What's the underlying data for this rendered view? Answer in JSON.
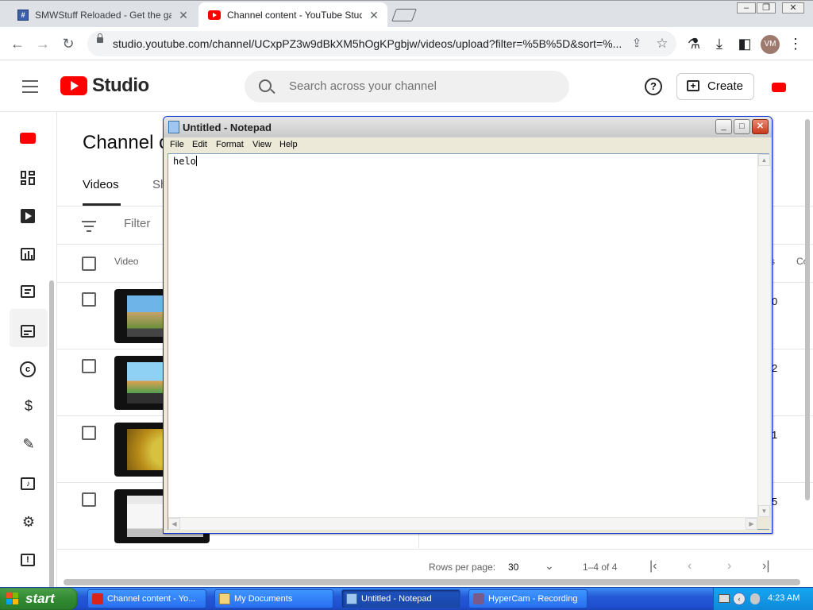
{
  "browser": {
    "tabs": [
      {
        "title": "SMWStuff Reloaded - Get the game",
        "favicon": "smw-favicon",
        "active": false
      },
      {
        "title": "Channel content - YouTube Studio",
        "favicon": "youtube-favicon",
        "active": true
      }
    ],
    "url": "studio.youtube.com/channel/UCxpPZ3w9dBkXM5hOgKPgbjw/videos/upload?filter=%5B%5D&sort=%...",
    "profile_initials": "VM"
  },
  "studio": {
    "logo_text": "Studio",
    "search_placeholder": "Search across your channel",
    "help_glyph": "?",
    "create_label": "Create",
    "page_title": "Channel c",
    "tabs": [
      {
        "label": "Videos"
      },
      {
        "label": "Sh"
      }
    ],
    "filter_label": "Filter",
    "table": {
      "video_header": "Video",
      "right_header_1": "s",
      "right_header_2": "Co",
      "rows": [
        {
          "value_fragment": "0"
        },
        {
          "value_fragment": "2"
        },
        {
          "value_fragment": "1"
        },
        {
          "value_fragment": "5"
        }
      ]
    },
    "pagination": {
      "rows_per_page_label": "Rows per page:",
      "rows_per_page_value": "30",
      "range": "1–4 of 4"
    },
    "sidebar_icons": [
      "channel-avatar-icon",
      "dashboard-icon",
      "content-icon",
      "analytics-icon",
      "comments-icon",
      "subtitles-icon",
      "copyright-icon",
      "earn-icon",
      "customization-icon",
      "audio-library-icon",
      "settings-icon",
      "feedback-icon"
    ]
  },
  "notepad": {
    "title": "Untitled - Notepad",
    "menu": [
      "File",
      "Edit",
      "Format",
      "View",
      "Help"
    ],
    "text": "helo"
  },
  "taskbar": {
    "start_label": "start",
    "items": [
      {
        "label": "Channel content - Yo...",
        "active": false
      },
      {
        "label": "My Documents",
        "active": false
      },
      {
        "label": "Untitled - Notepad",
        "active": true
      },
      {
        "label": "HyperCam - Recording",
        "active": false
      }
    ],
    "clock": "4:23 AM"
  },
  "colors": {
    "youtube_red": "#ff0000",
    "xp_blue": "#245edb",
    "xp_start_green": "#318a31"
  }
}
